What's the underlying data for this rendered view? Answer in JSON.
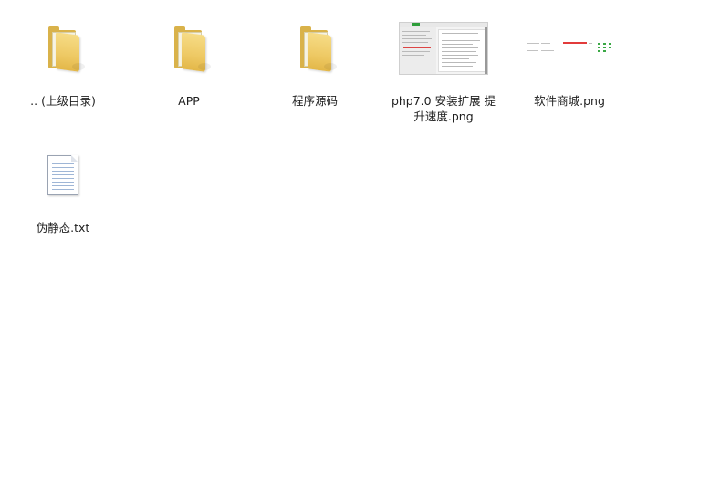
{
  "window": {
    "title": ""
  },
  "items": [
    {
      "type": "folder",
      "label": ".. (上级目录)",
      "icon": "folder-icon"
    },
    {
      "type": "folder",
      "label": "APP",
      "icon": "folder-icon"
    },
    {
      "type": "folder",
      "label": "程序源码",
      "icon": "folder-icon"
    },
    {
      "type": "image",
      "label": "php7.0 安装扩展 提升速度.png",
      "icon": "image-thumbnail"
    },
    {
      "type": "image",
      "label": "软件商城.png",
      "icon": "image-thumbnail"
    },
    {
      "type": "text",
      "label": "伪静态.txt",
      "icon": "text-file-icon"
    }
  ],
  "colors": {
    "folder": "#eec964",
    "accent_green": "#2e9e3a",
    "accent_red": "#e23b3b"
  }
}
